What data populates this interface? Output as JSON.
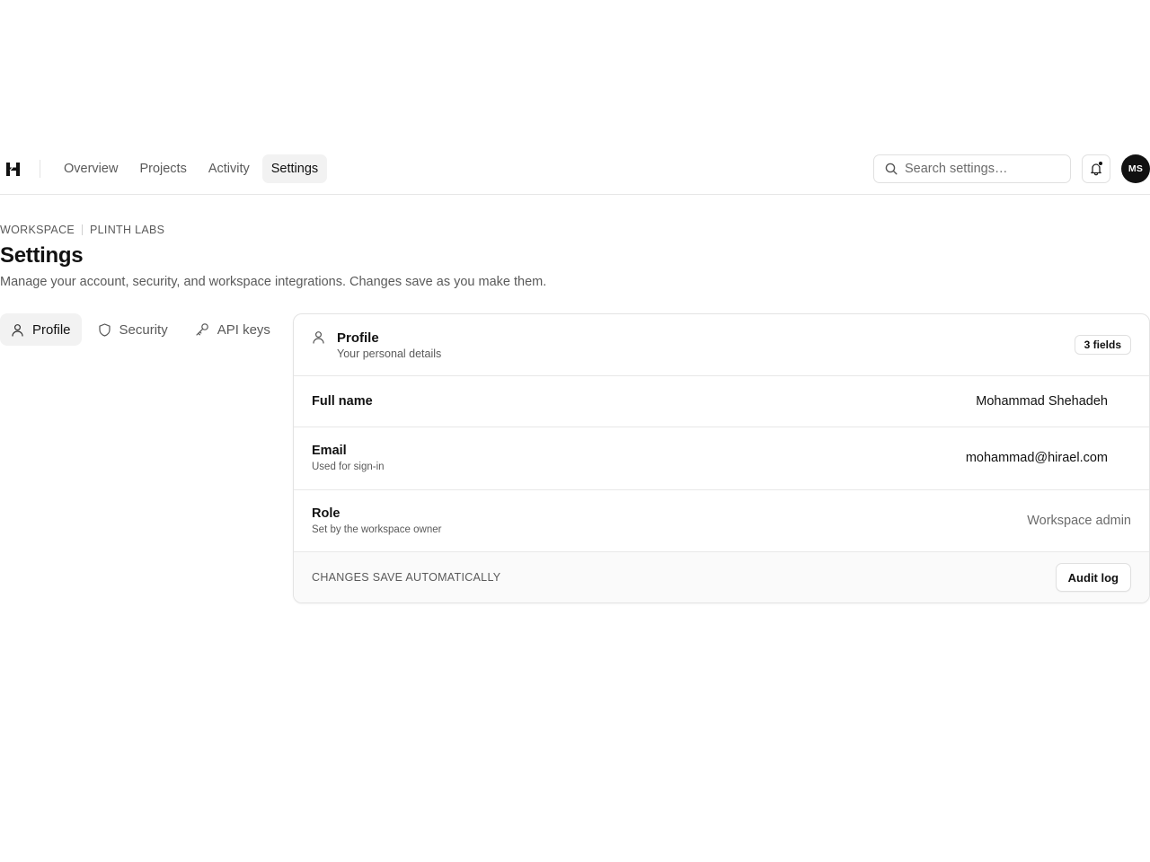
{
  "nav": {
    "logo_icon": "brand-h-logo-icon",
    "links": [
      {
        "label": "Overview",
        "active": false
      },
      {
        "label": "Projects",
        "active": false
      },
      {
        "label": "Activity",
        "active": false
      },
      {
        "label": "Settings",
        "active": true
      }
    ],
    "search": {
      "placeholder": "Search settings…",
      "value": "",
      "icon": "search-icon"
    },
    "notifications": {
      "icon": "bell-icon",
      "has_unread": true
    },
    "avatar": {
      "initials": "MS"
    }
  },
  "header": {
    "breadcrumb": [
      "WORKSPACE",
      "PLINTH LABS"
    ],
    "title": "Settings",
    "subtitle": "Manage your account, security, and workspace integrations. Changes save as you make them."
  },
  "tabs": [
    {
      "label": "Profile",
      "icon": "user-icon",
      "active": true
    },
    {
      "label": "Security",
      "icon": "shield-icon",
      "active": false
    },
    {
      "label": "API keys",
      "icon": "key-icon",
      "active": false
    }
  ],
  "card": {
    "icon": "user-icon",
    "title": "Profile",
    "subtitle": "Your personal details",
    "badge": "3 fields",
    "rows": [
      {
        "label": "Full name",
        "help": "",
        "value": "Mohammad Shehadeh",
        "editable": true
      },
      {
        "label": "Email",
        "help": "Used for sign-in",
        "value": "mohammad@hirael.com",
        "editable": true
      },
      {
        "label": "Role",
        "help": "Set by the workspace owner",
        "value": "Workspace admin",
        "editable": false
      }
    ],
    "footer": {
      "note": "CHANGES SAVE AUTOMATICALLY",
      "button": "Audit log"
    }
  },
  "colors": {
    "accent": "#111111",
    "muted_text": "#5a5a5a",
    "border": "#e3e3e3",
    "active_bg": "#f2f2f2"
  }
}
